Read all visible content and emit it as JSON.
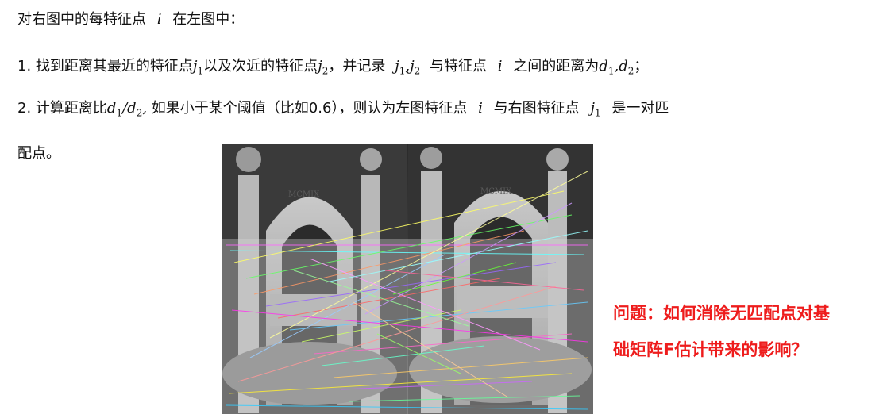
{
  "intro": {
    "pre": "对右图中的每特征点",
    "var": "i",
    "post": "在左图中："
  },
  "step1": {
    "text_a": "1. 找到距离其最近的特征点",
    "j1": "j",
    "j1_sub": "1",
    "text_b": "以及次近的特征点",
    "j2": "j",
    "j2_sub": "2",
    "text_c": "，并记录",
    "m1": "j",
    "m1_sub": "1",
    "comma1": ",",
    "m2": "j",
    "m2_sub": "2",
    "text_d": "与特征点",
    "var_i": "i",
    "text_e": "之间的距离为",
    "d1": "d",
    "d1_sub": "1",
    "comma2": ",",
    "d2": "d",
    "d2_sub": "2",
    "text_f": "；"
  },
  "step2": {
    "text_a": "2. 计算距离比",
    "d1": "d",
    "d1_sub": "1",
    "slash": "/",
    "d2": "d",
    "d2_sub": "2",
    "comma": ",",
    "text_b": "如果小于某个阈值（比如0.6），则认为左图特征点",
    "var_i": "i",
    "text_c": "与右图特征点",
    "j1": "j",
    "j1_sub": "1",
    "text_d": "是一对匹",
    "cont": "配点。"
  },
  "question": {
    "line1": "问题：如何消除无匹配点对基",
    "line2": "础矩阵F估计带来的影响？",
    "color": "#ee1c1c"
  },
  "figure": {
    "carving": "MCMIX"
  }
}
